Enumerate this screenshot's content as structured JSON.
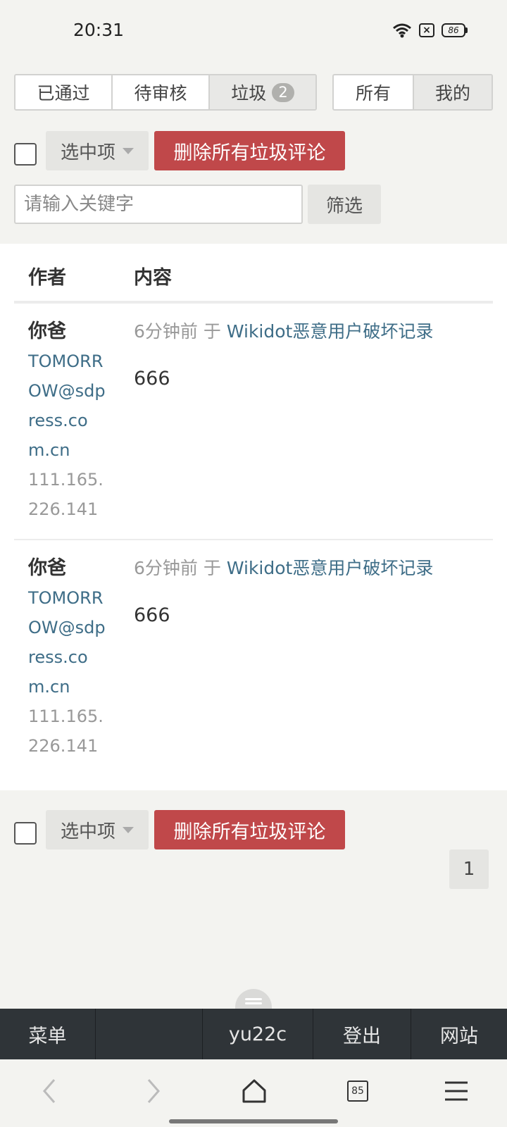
{
  "status_bar": {
    "time": "20:31",
    "battery": "86",
    "icons": [
      "wifi-icon",
      "close-box-icon",
      "battery-icon"
    ]
  },
  "status_tabs": [
    {
      "label": "已通过"
    },
    {
      "label": "待审核"
    },
    {
      "label": "垃圾",
      "badge": "2"
    }
  ],
  "scope_tabs": [
    {
      "label": "所有"
    },
    {
      "label": "我的"
    }
  ],
  "bulk_actions": {
    "select_label": "选中项",
    "delete_all_label": "删除所有垃圾评论"
  },
  "filter": {
    "placeholder": "请输入关键字",
    "button_label": "筛选",
    "value": ""
  },
  "table": {
    "headers": {
      "author": "作者",
      "content": "内容"
    },
    "rows": [
      {
        "author_name": "你爸",
        "author_email": "TOMORROW@sdpress.com.cn",
        "author_ip": "111.165.226.141",
        "time": "6分钟前",
        "preposition": "于",
        "page_link": "Wikidot恶意用户破坏记录",
        "body": "666"
      },
      {
        "author_name": "你爸",
        "author_email": "TOMORROW@sdpress.com.cn",
        "author_ip": "111.165.226.141",
        "time": "6分钟前",
        "preposition": "于",
        "page_link": "Wikidot恶意用户破坏记录",
        "body": "666"
      }
    ]
  },
  "pagination": {
    "current_page": "1"
  },
  "site_nav": {
    "menu": "菜单",
    "blank": "",
    "user": "yu22c",
    "logout": "登出",
    "site": "网站"
  },
  "browser_bar": {
    "tab_count": "85",
    "icons": [
      "back-icon",
      "forward-icon",
      "home-icon",
      "tabs-icon",
      "menu-icon"
    ]
  },
  "colors": {
    "danger": "#c0484a",
    "link": "#3e6d87",
    "nav_bg": "#2f3438",
    "page_bg": "#f3f3f0"
  }
}
